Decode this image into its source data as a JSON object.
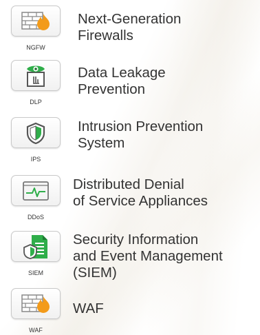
{
  "items": [
    {
      "abbr": "NGFW",
      "title": "Next-Generation\nFirewalls"
    },
    {
      "abbr": "DLP",
      "title": "Data Leakage\nPrevention"
    },
    {
      "abbr": "IPS",
      "title": "Intrusion Prevention\nSystem"
    },
    {
      "abbr": "DDoS",
      "title": "Distributed Denial\nof Service Appliances"
    },
    {
      "abbr": "SIEM",
      "title": "Security Information\nand Event Management\n(SIEM)"
    },
    {
      "abbr": "WAF",
      "title": "WAF"
    }
  ],
  "icons": [
    "firewall-icon",
    "eye-document-icon",
    "shield-icon",
    "monitor-pulse-icon",
    "shield-document-icon",
    "firewall-icon"
  ],
  "colors": {
    "flame_orange": "#f39b1a",
    "green": "#2fae4a",
    "text": "#333333"
  }
}
